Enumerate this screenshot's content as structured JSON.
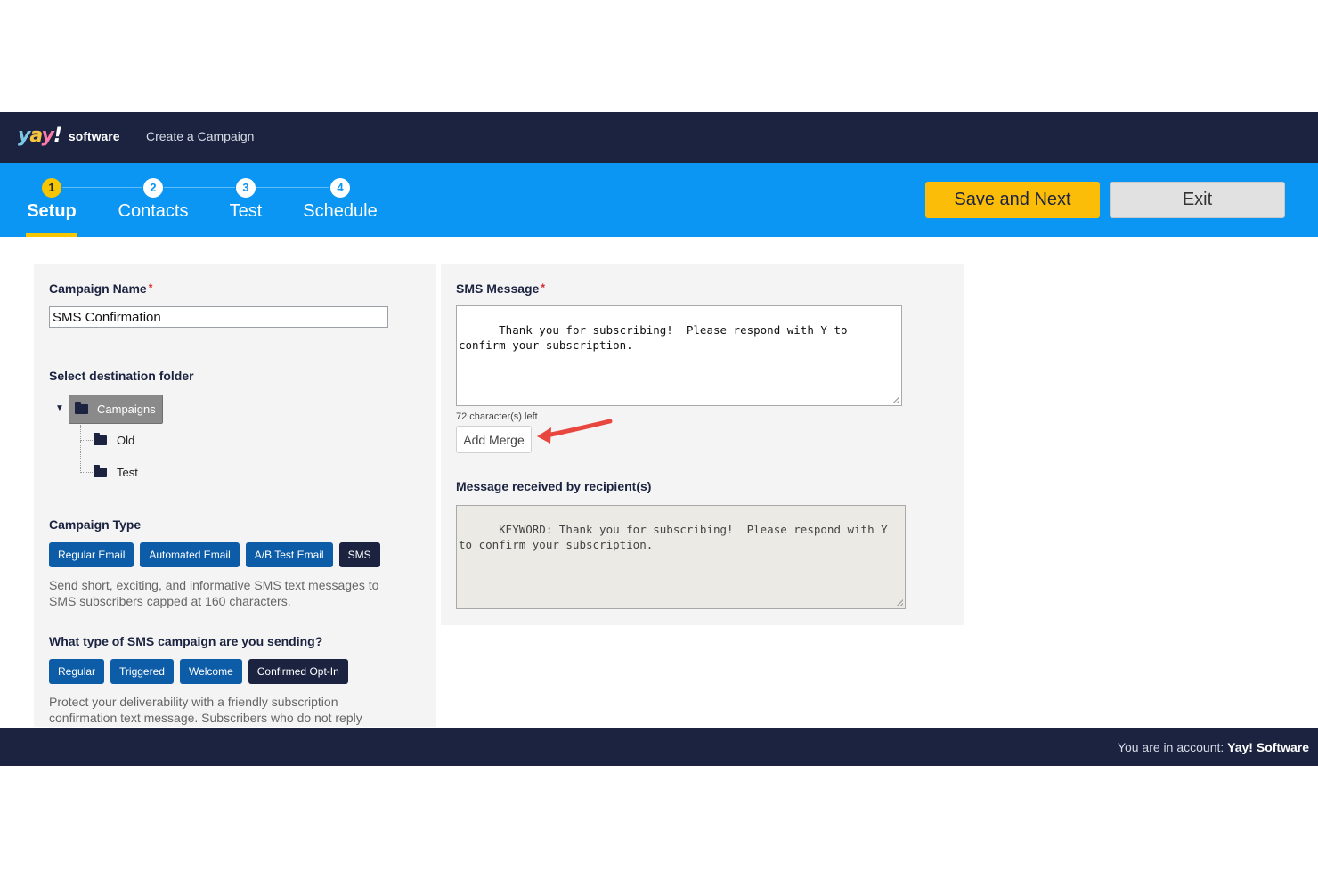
{
  "header": {
    "logo_text": "Yay!",
    "logo_suffix": "software",
    "breadcrumb": "Create a Campaign"
  },
  "steps": [
    {
      "num": "1",
      "label": "Setup",
      "active": true
    },
    {
      "num": "2",
      "label": "Contacts",
      "active": false
    },
    {
      "num": "3",
      "label": "Test",
      "active": false
    },
    {
      "num": "4",
      "label": "Schedule",
      "active": false
    }
  ],
  "actions": {
    "save_label": "Save and Next",
    "exit_label": "Exit"
  },
  "setup": {
    "campaign_name_label": "Campaign Name",
    "required_mark": "*",
    "campaign_name_value": "SMS Confirmation",
    "folder_label": "Select destination folder",
    "folders": {
      "root": "Campaigns",
      "children": [
        "Old",
        "Test"
      ]
    },
    "campaign_type_label": "Campaign Type",
    "campaign_types": [
      "Regular Email",
      "Automated Email",
      "A/B Test Email",
      "SMS"
    ],
    "campaign_type_selected": "SMS",
    "campaign_type_desc": "Send short, exciting, and informative SMS text messages to SMS subscribers capped at 160 characters.",
    "sms_type_label": "What type of SMS campaign are you sending?",
    "sms_types": [
      "Regular",
      "Triggered",
      "Welcome",
      "Confirmed Opt-In"
    ],
    "sms_type_selected": "Confirmed Opt-In",
    "sms_type_desc": "Protect your deliverability with a friendly subscription confirmation text message. Subscribers who do not reply"
  },
  "sms": {
    "message_label": "SMS Message",
    "message_value": "Thank you for subscribing!  Please respond with Y to confirm your subscription.",
    "chars_left": "72 character(s) left",
    "add_merge_label": "Add Merge",
    "received_label": "Message received by recipient(s)",
    "received_value": "KEYWORD: Thank you for subscribing!  Please respond with Y to confirm your subscription."
  },
  "footer": {
    "account_prefix": "You are in account:",
    "account_name": "Yay! Software"
  },
  "colors": {
    "navy": "#1b2340",
    "step_blue": "#0a96f2",
    "save_yellow": "#fbbd08",
    "pill_blue": "#0c5ca8",
    "arrow_red": "#e8473f"
  }
}
